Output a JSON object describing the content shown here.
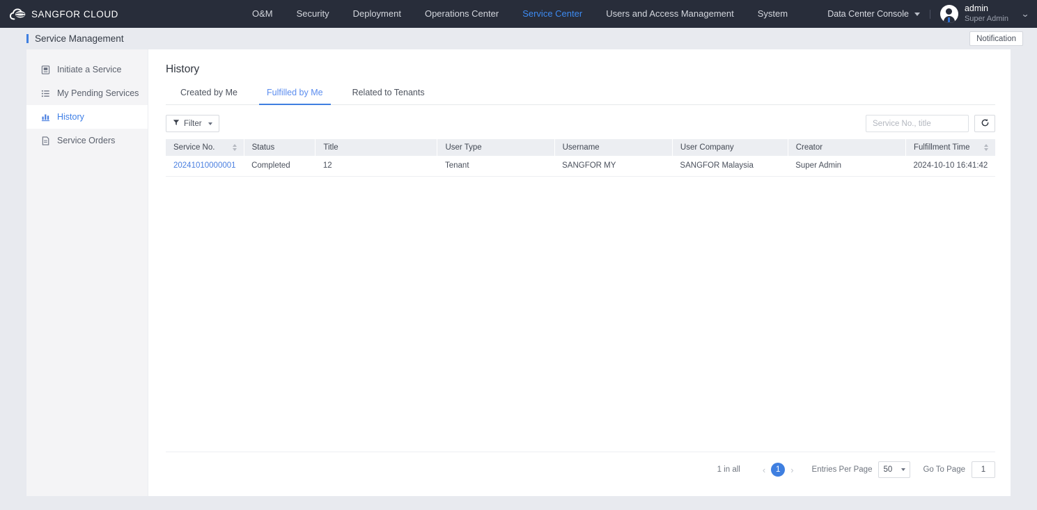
{
  "brand": {
    "name": "SANGFOR CLOUD",
    "logo_icon": "cloud-logo-icon"
  },
  "topnav": {
    "items": [
      {
        "label": "O&M",
        "active": false
      },
      {
        "label": "Security",
        "active": false
      },
      {
        "label": "Deployment",
        "active": false
      },
      {
        "label": "Operations Center",
        "active": false
      },
      {
        "label": "Service Center",
        "active": true
      },
      {
        "label": "Users and Access Management",
        "active": false
      },
      {
        "label": "System",
        "active": false
      }
    ],
    "console_switcher": "Data Center Console",
    "user": {
      "name": "admin",
      "role": "Super Admin"
    }
  },
  "subheader": {
    "title": "Service Management",
    "notification_label": "Notification"
  },
  "sidebar": {
    "items": [
      {
        "label": "Initiate a Service",
        "icon": "document-list-icon",
        "active": false
      },
      {
        "label": "My Pending Services",
        "icon": "list-icon",
        "active": false
      },
      {
        "label": "History",
        "icon": "bar-chart-icon",
        "active": true
      },
      {
        "label": "Service Orders",
        "icon": "file-icon",
        "active": false
      }
    ]
  },
  "main": {
    "title": "History",
    "tabs": [
      {
        "label": "Created by Me",
        "active": false
      },
      {
        "label": "Fulfilled by Me",
        "active": true
      },
      {
        "label": "Related to Tenants",
        "active": false
      }
    ],
    "toolbar": {
      "filter_label": "Filter",
      "search_placeholder": "Service No., title",
      "search_value": "",
      "search_icon": "search-icon",
      "refresh_icon": "refresh-icon"
    },
    "table": {
      "columns": [
        {
          "label": "Service No.",
          "sortable": true
        },
        {
          "label": "Status",
          "sortable": false
        },
        {
          "label": "Title",
          "sortable": false
        },
        {
          "label": "User Type",
          "sortable": false
        },
        {
          "label": "Username",
          "sortable": false
        },
        {
          "label": "User Company",
          "sortable": false
        },
        {
          "label": "Creator",
          "sortable": false
        },
        {
          "label": "Fulfillment Time",
          "sortable": true
        }
      ],
      "rows": [
        {
          "service_no": "20241010000001",
          "status": "Completed",
          "title": "12",
          "user_type": "Tenant",
          "username": "SANGFOR MY",
          "user_company": "SANGFOR Malaysia",
          "creator": "Super Admin",
          "fulfillment_time": "2024-10-10 16:41:42"
        }
      ]
    },
    "pagination": {
      "total_text": "1 in all",
      "prev_icon": "chevron-left-icon",
      "next_icon": "chevron-right-icon",
      "current_page": "1",
      "entries_label": "Entries Per Page",
      "entries_value": "50",
      "goto_label": "Go To Page",
      "goto_value": "1"
    }
  },
  "colors": {
    "topbar_bg": "#282d3a",
    "accent_blue": "#3f7fe0",
    "link_blue": "#4a7fe0",
    "page_bg": "#e8eaef",
    "sidebar_bg": "#f4f4f6",
    "table_header_bg": "#eceef2"
  }
}
